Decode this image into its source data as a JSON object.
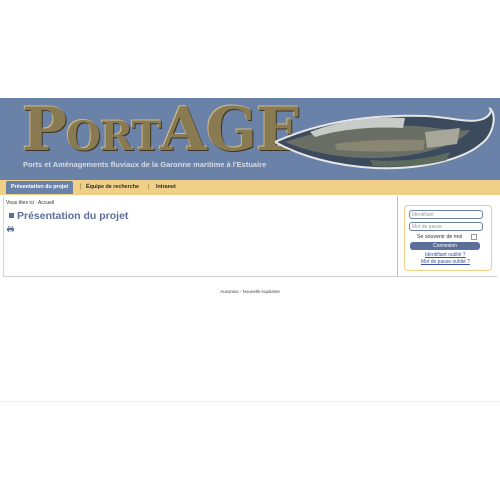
{
  "header": {
    "logo_text_part1": "P",
    "logo_text_part2": "ORT",
    "logo_text_part3": "AGE",
    "tagline": "Ports et Aménagements fluviaux de la Garonne maritime à l'Estuaire"
  },
  "nav": {
    "tabs": [
      {
        "label": "Présentation du projet",
        "active": true
      },
      {
        "label": "Équipe de recherche",
        "active": false
      },
      {
        "label": "Intranet",
        "active": false
      }
    ]
  },
  "main": {
    "breadcrumb_prefix": "Vous êtes ici :",
    "breadcrumb_current": "Accueil",
    "title": "Présentation du projet"
  },
  "login": {
    "username_placeholder": "Identifiant",
    "password_placeholder": "Mot de passe",
    "remember_label": "Se souvenir de moi",
    "submit_label": "Connexion",
    "forgot_username": "Identifiant oublié ?",
    "forgot_password": "Mot de passe oublié ?"
  },
  "footer": {
    "text": "Ausonius - Nouvelle Aquitaine"
  },
  "colors": {
    "banner": "#6b82a8",
    "nav": "#f0cf86",
    "title": "#5b6f98",
    "button": "#5b6f98"
  }
}
